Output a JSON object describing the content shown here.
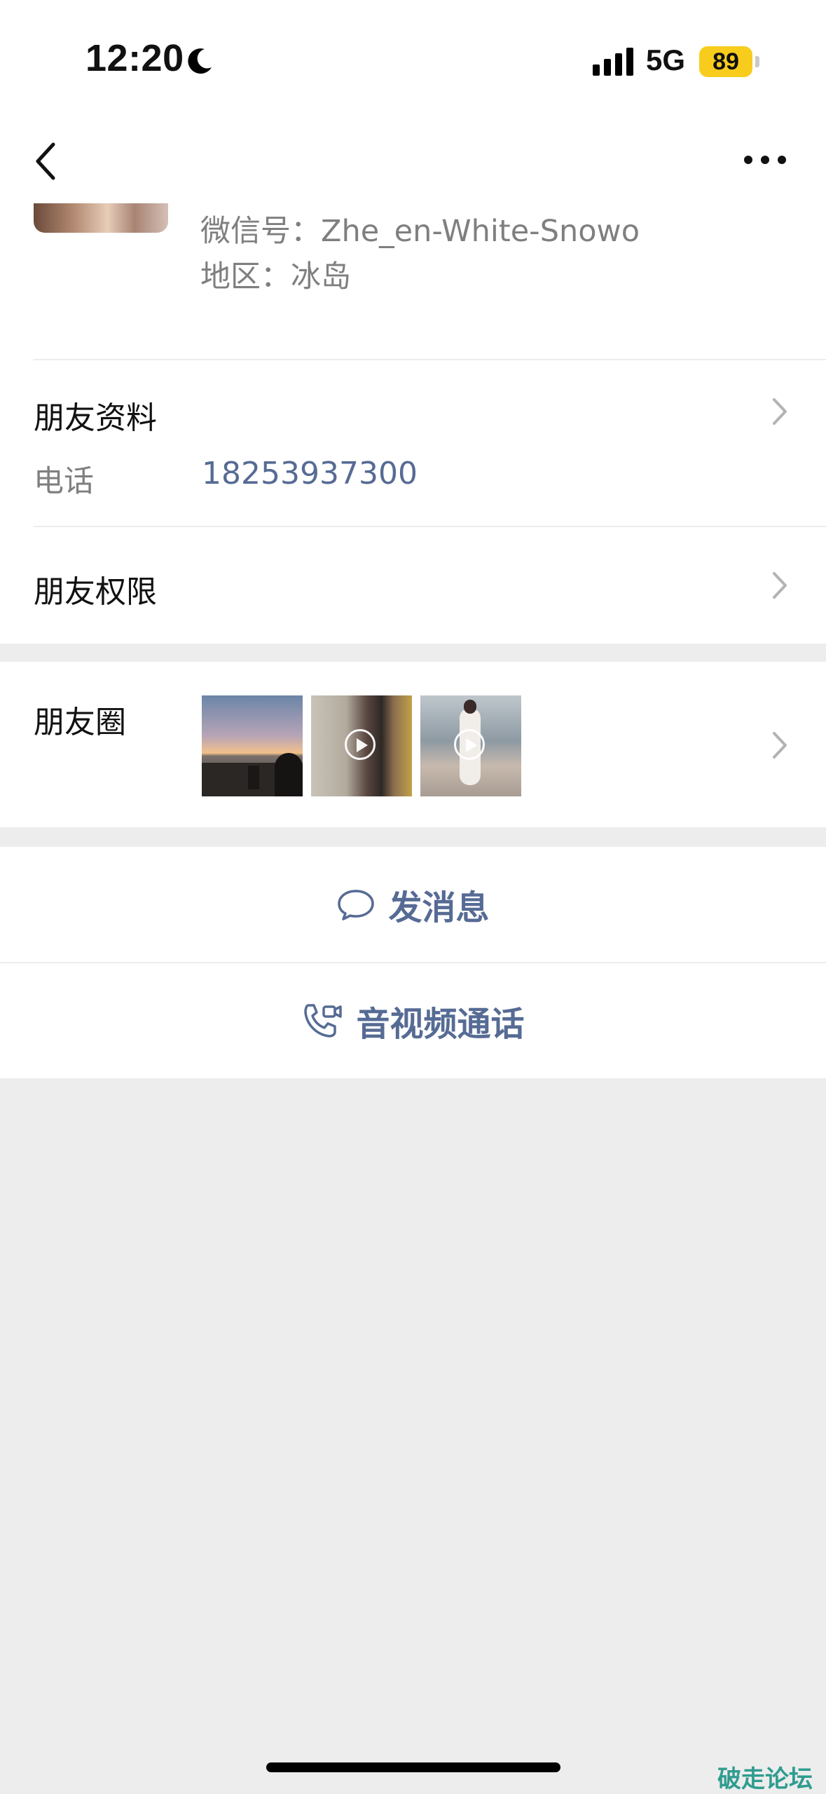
{
  "status_bar": {
    "time": "12:20",
    "network": "5G",
    "battery": "89",
    "battery_color": "#f7cc1c",
    "icons": [
      "moon-icon",
      "signal-icon"
    ]
  },
  "nav": {
    "back_icon": "chevron-left-icon",
    "more_icon": "more-dots-icon"
  },
  "profile": {
    "wechat_id": "微信号：Zhe_en-White-Snowo",
    "region": "地区：冰岛"
  },
  "friend_info": {
    "title": "朋友资料",
    "phone_label": "电话",
    "phone_value": "18253937300"
  },
  "permissions": {
    "title": "朋友权限"
  },
  "moments": {
    "title": "朋友圈",
    "thumbnails": [
      "sunset-photo",
      "video-thumbnail",
      "video-thumbnail"
    ]
  },
  "actions": {
    "message_label": "发消息",
    "call_label": "音视频通话"
  },
  "watermark": "破走论坛",
  "colors": {
    "link_blue": "#566b94",
    "background_gray": "#ededed"
  }
}
